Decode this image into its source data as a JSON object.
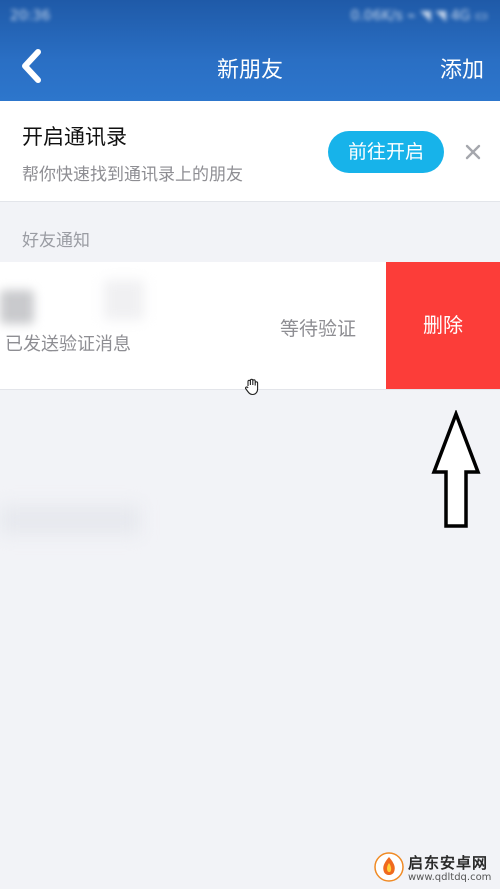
{
  "statusbar": {
    "time": "20:36",
    "right": "0.06K/s ⌁ ◥ ◥ 4G ▭"
  },
  "header": {
    "title": "新朋友",
    "add_label": "添加",
    "color": "#2a6fc4"
  },
  "contacts_banner": {
    "title": "开启通讯录",
    "subtitle": "帮你快速找到通讯录上的朋友",
    "button_label": "前往开启",
    "button_color": "#17b3ea"
  },
  "friend_notifications": {
    "section_label": "好友通知",
    "items": [
      {
        "message": "已发送验证消息",
        "status": "等待验证",
        "delete_label": "删除",
        "delete_color": "#fc3d39"
      }
    ]
  },
  "watermark": {
    "brand": "启东安卓网",
    "url": "www.qdltdq.com"
  }
}
